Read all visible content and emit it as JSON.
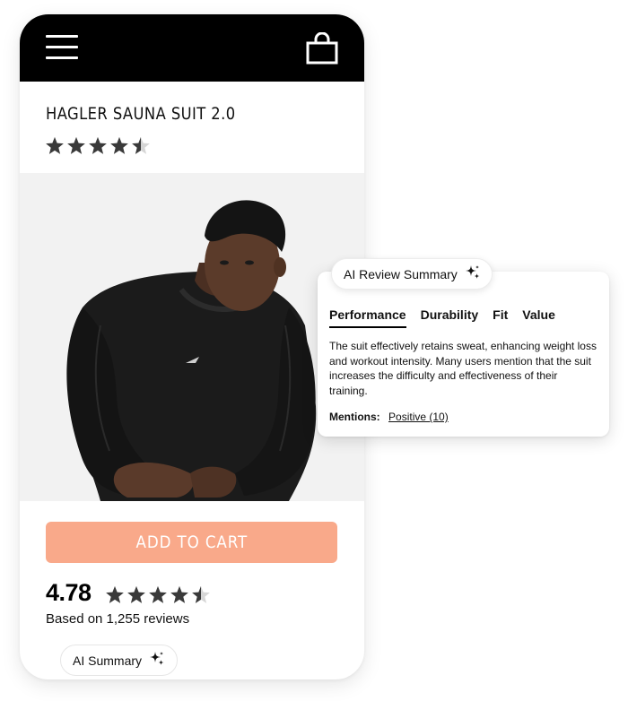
{
  "header": {
    "menu_icon": "hamburger-menu-icon",
    "bag_icon": "shopping-bag-icon",
    "background": "#000000"
  },
  "product": {
    "title": "HAGLER SAUNA SUIT 2.0",
    "rating_stars": 4.5,
    "image": "man-in-black-sauna-suit-photo"
  },
  "cart": {
    "button_label": "ADD TO CART",
    "button_color": "#f9a98a"
  },
  "reviews": {
    "average": "4.78",
    "rating_stars": 4.5,
    "count_text": "Based on 1,255 reviews",
    "ai_button_label": "AI Summary",
    "ai_icon": "sparkle-icon"
  },
  "summary_card": {
    "pill_label": "AI Review Summary",
    "pill_icon": "sparkle-icon",
    "tabs": [
      "Performance",
      "Durability",
      "Fit",
      "Value"
    ],
    "active_tab": "Performance",
    "text": "The suit effectively retains sweat, enhancing weight loss and workout intensity. Many users mention that the suit increases the difficulty and effectiveness of their training.",
    "mentions_label": "Mentions:",
    "mentions_value": "Positive (10)"
  }
}
